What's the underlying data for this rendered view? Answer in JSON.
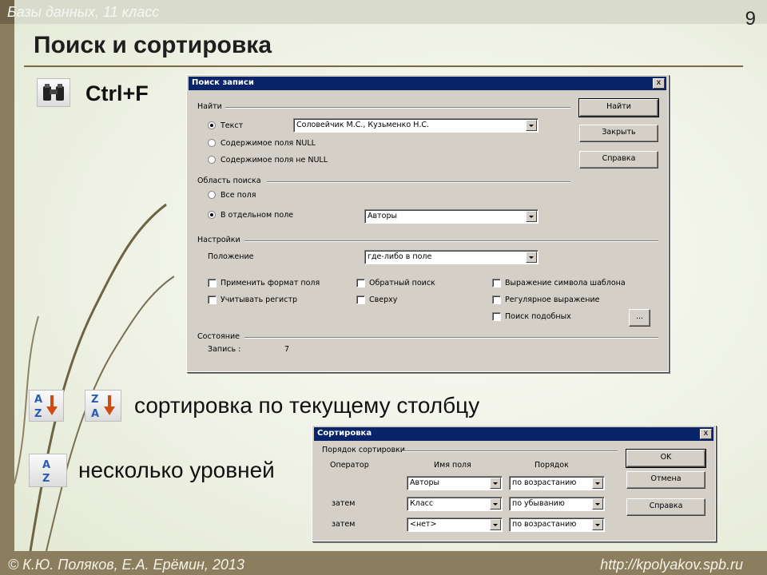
{
  "slide": {
    "course": "Базы данных, 11 класс",
    "page_number": "9",
    "title": "Поиск и сортировка",
    "hotkey": "Ctrl+F",
    "sort_text": "сортировка по текущему столбцу",
    "multi_level_text": "несколько уровней",
    "author": "© К.Ю. Поляков, Е.А. Ерёмин, 2013",
    "url": "http://kpolyakov.spb.ru"
  },
  "icons": {
    "find": "binoculars-icon",
    "sort_asc": "sort-ascending-icon",
    "sort_desc": "sort-descending-icon",
    "sort_dialog": "sort-icon",
    "sort_icon_letters": {
      "top": "A",
      "bottom": "Z"
    },
    "sort_desc_icon_letters": {
      "top": "Z",
      "bottom": "A"
    }
  },
  "colors": {
    "titlebar": "#0a246a",
    "dialog": "#d4d0c8",
    "accent_bar": "#8b7e5f"
  },
  "find_dialog": {
    "title": "Поиск записи",
    "close": "x",
    "find_group": "Найти",
    "radio_text": "Текст",
    "radio_text_checked": true,
    "text_value": "Соловейчик М.С., Кузьменко Н.С.",
    "radio_field_content": "Содержимое поля NULL",
    "radio_field_not_null": "Содержимое поля не NULL",
    "area_group": "Область поиска",
    "radio_all_fields": "Все поля",
    "radio_single_field": "В отдельном поле",
    "radio_single_field_checked": true,
    "field_value": "Авторы",
    "settings_group": "Настройки",
    "position_label": "Положение",
    "position_value": "где-либо в поле",
    "options": [
      {
        "label": "Применить формат поля",
        "checked": false
      },
      {
        "label": "Учитывать регистр",
        "checked": false
      },
      {
        "label": "Обратный поиск",
        "checked": false
      },
      {
        "label": "Сверху",
        "checked": false
      },
      {
        "label": "Выражение символа шаблона",
        "checked": false
      },
      {
        "label": "Регулярное выражение",
        "checked": false
      },
      {
        "label": "Поиск подобных",
        "checked": false
      }
    ],
    "ellipsis_button": "...",
    "status_group": "Состояние",
    "record_label": "Запись :",
    "record_value": "7",
    "buttons": {
      "find": "Найти",
      "close": "Закрыть",
      "help": "Справка"
    }
  },
  "sort_dialog": {
    "title": "Сортировка",
    "close": "x",
    "group": "Порядок сортировки",
    "headers": {
      "operator": "Оператор",
      "field": "Имя поля",
      "order": "Порядок"
    },
    "rows": [
      {
        "operator": "",
        "field": "Авторы",
        "order": "по возрастанию"
      },
      {
        "operator": "затем",
        "field": "Класс",
        "order": "по убыванию"
      },
      {
        "operator": "затем",
        "field": "<нет>",
        "order": "по возрастанию"
      }
    ],
    "buttons": {
      "ok": "OK",
      "cancel": "Отмена",
      "help": "Справка"
    }
  }
}
